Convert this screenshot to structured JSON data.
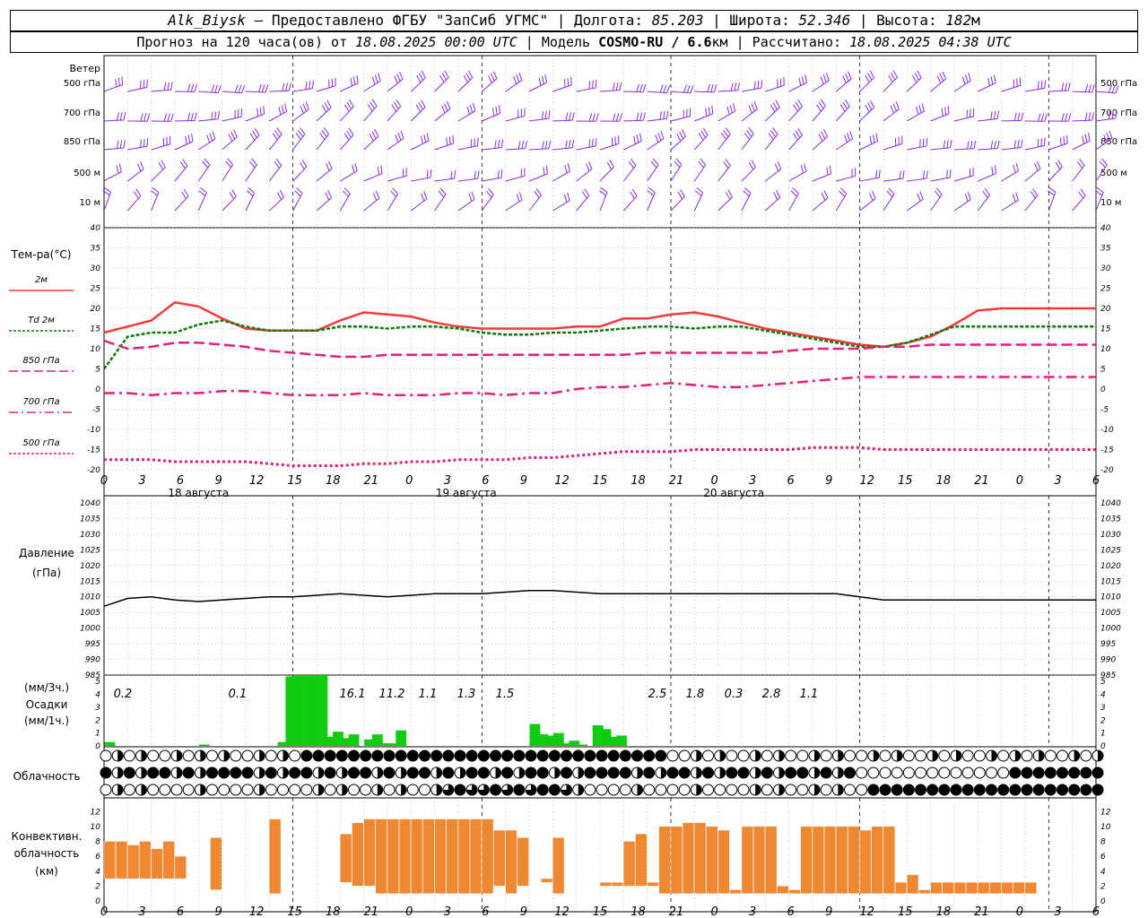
{
  "header": {
    "station": "Alk_Biysk",
    "provider": " — Предоставлено ФГБУ \"ЗапСиб УГМС\" | Долгота: ",
    "lon": "85.203",
    "lat_label": " | Широта: ",
    "lat": "52.346",
    "alt_label": " | Высота: ",
    "alt": "182",
    "alt_unit": "м",
    "forecast_label": "Прогноз на 120 часа(ов) от ",
    "forecast_date": "18.08.2025 00:00 UTC",
    "model_label": " | Модель ",
    "model": "COSMO-RU / 6.6",
    "model_unit": "км",
    "calc_label": " | Рассчитано: ",
    "calc_date": "18.08.2025 04:38 UTC"
  },
  "colors": {
    "wind": "#8a2be2",
    "t2m": "#ee3b3b",
    "td": "#0a7a0a",
    "t850": "#e0207a",
    "t700": "#e0207a",
    "t500": "#e0207a",
    "pressure": "#000000",
    "precip": "#11cc11",
    "convective": "#ee8833"
  },
  "time_axis": {
    "hour_labels": [
      "0",
      "3",
      "6",
      "9",
      "12",
      "15",
      "18",
      "21",
      "0",
      "3",
      "6",
      "9",
      "12",
      "15",
      "18",
      "21",
      "0",
      "3",
      "6",
      "9",
      "12",
      "15",
      "18",
      "21",
      "0",
      "3",
      "6"
    ],
    "day_labels": [
      "18 августа",
      "19 августа",
      "20 августа"
    ]
  },
  "wind_panel": {
    "title": "Ветер",
    "levels": [
      "500 гПа",
      "700 гПа",
      "850 гПа",
      "500 м",
      "10 м"
    ]
  },
  "temp_panel": {
    "title": "Тем-ра(°C)",
    "legend": [
      {
        "label": "2м"
      },
      {
        "label": "Td  2м"
      },
      {
        "label": "850 гПа"
      },
      {
        "label": "700 гПа"
      },
      {
        "label": "500 гПа"
      }
    ],
    "ticks": [
      "40",
      "35",
      "30",
      "25",
      "20",
      "15",
      "10",
      "5",
      "0",
      "-5",
      "-10",
      "-15",
      "-20"
    ]
  },
  "pressure_panel": {
    "title": "Давление",
    "unit": "(гПа)",
    "ticks": [
      "1040",
      "1035",
      "1030",
      "1025",
      "1020",
      "1015",
      "1010",
      "1005",
      "1000",
      "995",
      "990",
      "985"
    ]
  },
  "precip_panel": {
    "unit_3h": "(мм/3ч.)",
    "title": "Осадки",
    "unit_1h": "(мм/1ч.)",
    "ticks": [
      "5",
      "4",
      "3",
      "2",
      "1",
      "0"
    ],
    "sums": [
      "0.2",
      "0.1",
      "16.1",
      "11.2",
      "1.1",
      "1.3",
      "1.5",
      "2.5",
      "1.8",
      "0.3",
      "2.8",
      "1.1"
    ]
  },
  "cloud_panel": {
    "title": "Облачность"
  },
  "conv_panel": {
    "title1": "Конвективн.",
    "title2": "облачность",
    "unit": "(км)",
    "ticks": [
      "12",
      "10",
      "8",
      "6",
      "4",
      "2",
      "0"
    ]
  },
  "chart_data": [
    {
      "type": "line",
      "title": "Тем-ра(°C)",
      "x_hours": [
        0,
        3,
        6,
        9,
        12,
        15,
        18,
        21,
        24,
        27,
        30,
        33,
        36,
        39,
        42,
        45,
        48,
        51,
        54,
        57,
        60,
        63,
        66,
        69,
        72,
        75,
        78,
        81,
        84,
        87,
        90,
        93,
        96,
        99,
        102,
        105,
        108,
        111,
        114,
        117,
        120,
        123,
        126
      ],
      "ylim": [
        -20,
        40
      ],
      "series": [
        {
          "name": "2м",
          "values": [
            14,
            15.5,
            17,
            21.5,
            20.5,
            17.5,
            15,
            14.5,
            14.5,
            14.5,
            17,
            19,
            18.5,
            18,
            16.5,
            15.5,
            15,
            15,
            15,
            15,
            15.5,
            15.5,
            17.5,
            17.5,
            18.5,
            19,
            18,
            16.5,
            15,
            14,
            13,
            12,
            11,
            10.5,
            11.5,
            13,
            16,
            19.5,
            20,
            20,
            20,
            20,
            20
          ]
        },
        {
          "name": "Td  2м",
          "values": [
            5,
            13,
            14,
            14,
            16,
            17,
            15.5,
            14.5,
            14.5,
            14.5,
            15.5,
            15.5,
            15,
            15.5,
            15.5,
            15,
            14,
            13.5,
            13.5,
            14,
            14,
            14.5,
            15,
            15.5,
            15.5,
            15,
            15.5,
            15.5,
            14.5,
            13.5,
            12.5,
            11.5,
            10.5,
            10.5,
            11.5,
            13.5,
            15.5,
            15.5,
            15.5,
            15.5,
            15.5,
            15.5,
            15.5
          ]
        },
        {
          "name": "850 гПа",
          "values": [
            12,
            10,
            10.5,
            11.5,
            11.5,
            11,
            10.5,
            9.5,
            9,
            8.5,
            8,
            8,
            8.5,
            8.5,
            8.5,
            8.5,
            8.5,
            8.5,
            8.5,
            8.5,
            8.5,
            8.5,
            8.5,
            9,
            9,
            9,
            9,
            9,
            9,
            9.5,
            10,
            10,
            10,
            10.5,
            10.5,
            11,
            11,
            11,
            11,
            11,
            11,
            11,
            11
          ]
        },
        {
          "name": "700 гПа",
          "values": [
            -1,
            -1,
            -1.5,
            -1,
            -1,
            -0.5,
            -0.5,
            -1,
            -1.5,
            -1.5,
            -1.5,
            -1,
            -1.5,
            -1.5,
            -1.5,
            -1,
            -1,
            -1.5,
            -1,
            -1,
            0,
            0.5,
            0.5,
            1,
            1.5,
            1,
            0.5,
            0.5,
            1,
            1.5,
            2,
            2.5,
            3,
            3,
            3,
            3,
            3,
            3,
            3,
            3,
            3,
            3,
            3
          ]
        },
        {
          "name": "500 гПа",
          "values": [
            -17.5,
            -17.5,
            -17.5,
            -18,
            -18,
            -18,
            -18,
            -18.5,
            -19,
            -19,
            -19,
            -18.5,
            -18.5,
            -18,
            -18,
            -17.5,
            -17.5,
            -17.5,
            -17,
            -17,
            -16.5,
            -16,
            -15.5,
            -15.5,
            -15.5,
            -15,
            -15,
            -15,
            -15,
            -15,
            -14.5,
            -14.5,
            -14.5,
            -15,
            -15,
            -15,
            -15,
            -15,
            -15,
            -15,
            -15,
            -15,
            -15
          ]
        }
      ]
    },
    {
      "type": "line",
      "title": "Давление",
      "ylim": [
        985,
        1040
      ],
      "x_hours": [
        0,
        3,
        6,
        9,
        12,
        15,
        18,
        21,
        24,
        27,
        30,
        33,
        36,
        39,
        42,
        45,
        48,
        51,
        54,
        57,
        60,
        63,
        66,
        69,
        72,
        75,
        78,
        81,
        84,
        87,
        90,
        93,
        96,
        99,
        102,
        105,
        108,
        111,
        114,
        117,
        120,
        123,
        126
      ],
      "series": [
        {
          "name": "",
          "values": [
            1007,
            1009.5,
            1010,
            1009,
            1008.5,
            1009,
            1009.5,
            1010,
            1010,
            1010.5,
            1011,
            1010.5,
            1010,
            1010.5,
            1011,
            1011,
            1011,
            1011.5,
            1012,
            1012,
            1011.5,
            1011,
            1011,
            1011,
            1011,
            1011,
            1011,
            1011,
            1011,
            1011,
            1011,
            1011,
            1010,
            1009,
            1009,
            1009,
            1009,
            1009,
            1009,
            1009,
            1009,
            1009,
            1009
          ]
        }
      ]
    },
    {
      "type": "bar",
      "title": "Осадки",
      "ylim": [
        0,
        5.5
      ],
      "bars_hour_mm": [
        [
          0,
          0.3
        ],
        [
          12,
          0.1
        ],
        [
          22,
          0.3
        ],
        [
          23,
          5.4
        ],
        [
          24,
          5.5
        ],
        [
          25,
          5.5
        ],
        [
          26,
          5.5
        ],
        [
          27,
          5.5
        ],
        [
          28,
          0.7
        ],
        [
          29,
          1.1
        ],
        [
          30,
          0.6
        ],
        [
          31,
          0.9
        ],
        [
          33,
          0.5
        ],
        [
          34,
          0.9
        ],
        [
          35,
          0.2
        ],
        [
          36,
          0.2
        ],
        [
          37,
          1.2
        ],
        [
          54,
          1.7
        ],
        [
          55,
          0.9
        ],
        [
          56,
          0.8
        ],
        [
          57,
          1.0
        ],
        [
          58,
          0.2
        ],
        [
          59,
          0.4
        ],
        [
          60,
          0.1
        ],
        [
          62,
          1.6
        ],
        [
          63,
          1.3
        ],
        [
          64,
          0.7
        ],
        [
          65,
          0.8
        ]
      ]
    },
    {
      "type": "bar",
      "title": "Конвективная облачность (км)",
      "ylim": [
        0,
        13
      ],
      "bars_hour_km": [
        [
          0,
          3,
          8
        ],
        [
          1,
          3,
          8
        ],
        [
          2,
          3,
          7.5
        ],
        [
          3,
          3,
          8
        ],
        [
          4,
          3,
          7
        ],
        [
          5,
          3,
          8
        ],
        [
          6,
          3,
          6
        ],
        [
          9,
          1.5,
          8.5
        ],
        [
          14,
          1,
          11
        ],
        [
          20,
          2.5,
          9
        ],
        [
          21,
          2,
          10.5
        ],
        [
          22,
          2,
          11
        ],
        [
          23,
          1,
          11
        ],
        [
          24,
          1,
          11
        ],
        [
          25,
          1,
          11
        ],
        [
          26,
          1,
          11
        ],
        [
          27,
          1,
          11
        ],
        [
          28,
          1,
          11
        ],
        [
          29,
          1,
          11
        ],
        [
          30,
          1,
          11
        ],
        [
          31,
          1,
          11
        ],
        [
          32,
          1,
          11
        ],
        [
          33,
          2,
          9.5
        ],
        [
          34,
          1,
          9.5
        ],
        [
          35,
          2,
          8.5
        ],
        [
          37,
          2.5,
          3
        ],
        [
          38,
          1,
          8.5
        ],
        [
          42,
          2,
          2.5
        ],
        [
          43,
          2,
          2.5
        ],
        [
          44,
          2,
          8
        ],
        [
          45,
          2,
          9
        ],
        [
          46,
          2,
          2.5
        ],
        [
          47,
          1,
          10
        ],
        [
          48,
          1,
          10
        ],
        [
          49,
          1,
          10.5
        ],
        [
          50,
          1,
          10.5
        ],
        [
          51,
          1,
          10
        ],
        [
          52,
          1,
          9.5
        ],
        [
          53,
          1,
          1.5
        ],
        [
          54,
          1,
          10
        ],
        [
          55,
          1,
          10
        ],
        [
          56,
          1,
          10
        ],
        [
          57,
          1,
          2
        ],
        [
          58,
          1,
          1.5
        ],
        [
          59,
          1,
          10
        ],
        [
          60,
          1,
          10
        ],
        [
          61,
          1,
          10
        ],
        [
          62,
          1,
          10
        ],
        [
          63,
          1,
          10
        ],
        [
          64,
          1,
          9.5
        ],
        [
          65,
          1,
          10
        ],
        [
          66,
          1,
          10
        ],
        [
          67,
          1,
          2.5
        ],
        [
          68,
          1,
          3.5
        ],
        [
          69,
          1,
          1.5
        ],
        [
          70,
          1,
          2.5
        ],
        [
          71,
          1,
          2.5
        ],
        [
          72,
          1,
          2.5
        ],
        [
          73,
          1,
          2.5
        ],
        [
          74,
          1,
          2.5
        ],
        [
          75,
          1,
          2.5
        ],
        [
          76,
          1,
          2.5
        ],
        [
          77,
          1,
          2.5
        ],
        [
          78,
          1,
          2.5
        ]
      ]
    }
  ]
}
